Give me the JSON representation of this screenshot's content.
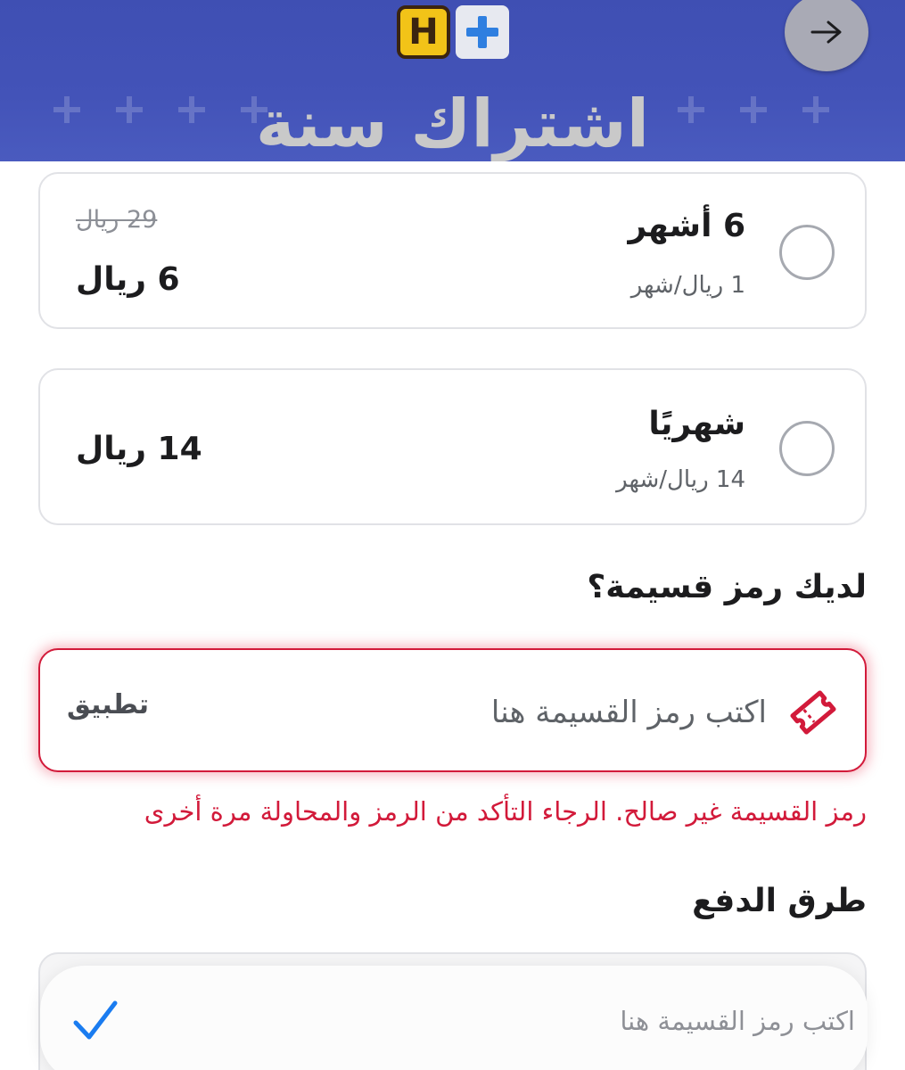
{
  "header": {
    "plan_title": "اشتراك سنة",
    "logo": {
      "letter": "H",
      "plus_icon": "plus-icon"
    },
    "back_icon": "arrow-right-icon",
    "colors": {
      "header_bg": "#4353b8",
      "logo_yellow": "#f2c318",
      "logo_blue": "#2f7fe0"
    }
  },
  "plans": [
    {
      "name": "6 أشهر",
      "per_month": "1 ريال/شهر",
      "old_price": "29 ريال",
      "price": "6 ريال",
      "selected": false
    },
    {
      "name": "شهريًا",
      "per_month": "14 ريال/شهر",
      "price": "14 ريال",
      "selected": false
    }
  ],
  "coupon": {
    "section_title": "لديك رمز قسيمة؟",
    "placeholder": "اكتب رمز القسيمة هنا",
    "apply_label": "تطبيق",
    "error": "رمز القسيمة غير صالح. الرجاء التأكد من الرمز والمحاولة مرة أخرى",
    "icon": "ticket-icon",
    "error_color": "#d21a3a"
  },
  "payment": {
    "section_title": "طرق الدفع"
  },
  "assist_bar": {
    "text": "اكتب رمز القسيمة هنا",
    "icon": "checkmark-icon",
    "check_color": "#1a7cf0"
  }
}
